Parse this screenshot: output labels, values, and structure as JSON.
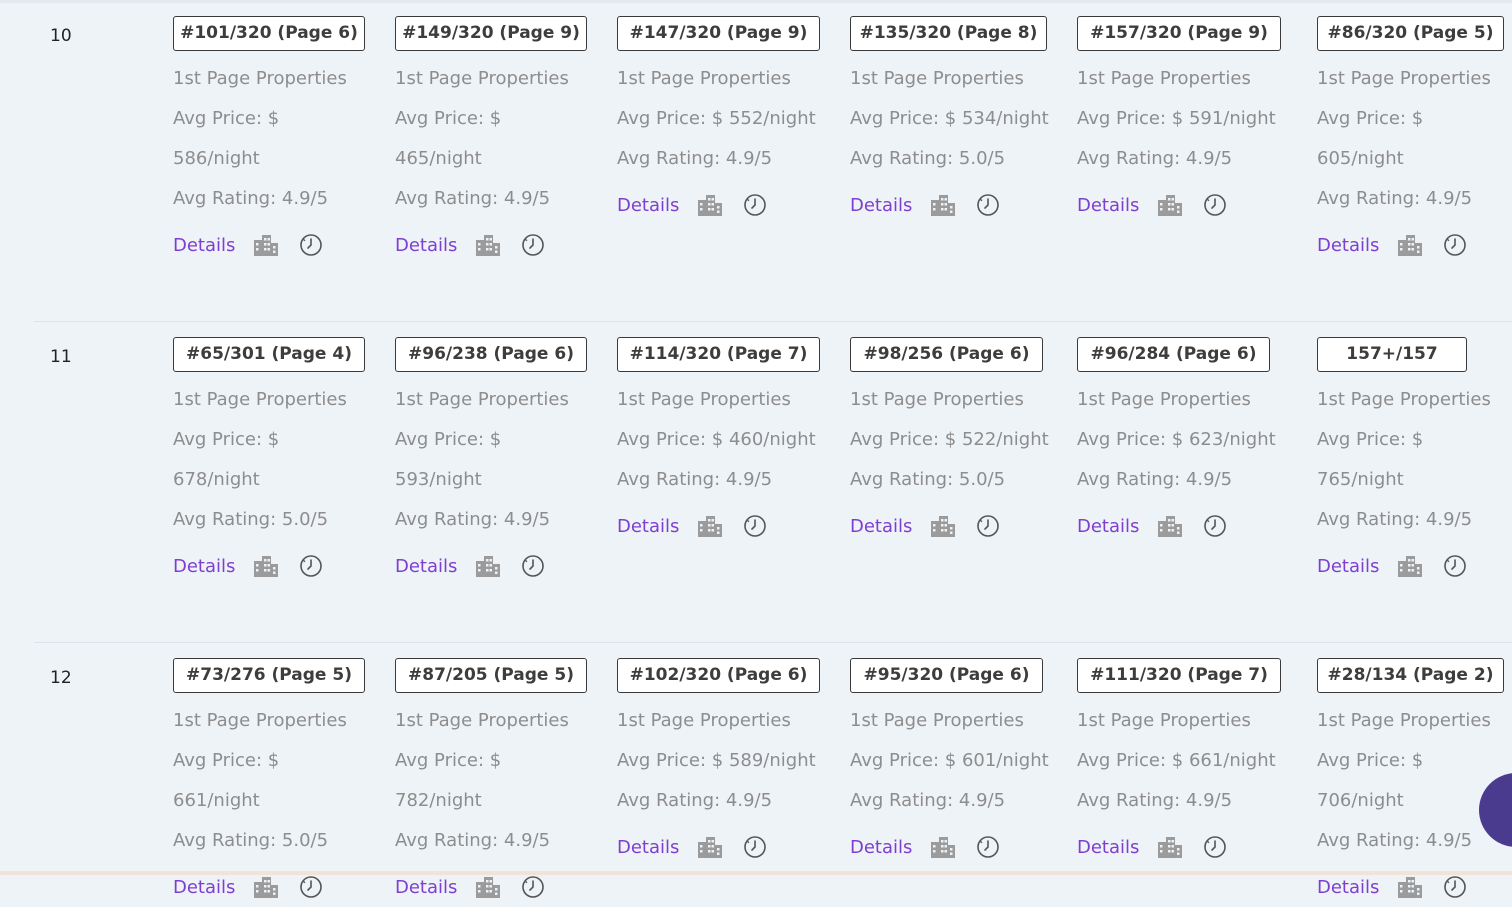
{
  "labels": {
    "first_page": "1st Page Properties",
    "avg_price_prefix": "Avg Price: $",
    "avg_rating_prefix": "Avg Rating: ",
    "details": "Details",
    "help": "?"
  },
  "rows": [
    {
      "number": "10",
      "cells": [
        {
          "rank": "#101/320 (Page 6)",
          "price": "586/night",
          "rating": "4.9/5"
        },
        {
          "rank": "#149/320 (Page 9)",
          "price": "465/night",
          "rating": "4.9/5"
        },
        {
          "rank": "#147/320 (Page 9)",
          "price": "552/night",
          "rating": "4.9/5"
        },
        {
          "rank": "#135/320 (Page 8)",
          "price": "534/night",
          "rating": "5.0/5"
        },
        {
          "rank": "#157/320 (Page 9)",
          "price": "591/night",
          "rating": "4.9/5"
        },
        {
          "rank": "#86/320 (Page 5)",
          "price": "605/night",
          "rating": "4.9/5"
        }
      ]
    },
    {
      "number": "11",
      "cells": [
        {
          "rank": "#65/301 (Page 4)",
          "price": "678/night",
          "rating": "5.0/5"
        },
        {
          "rank": "#96/238 (Page 6)",
          "price": "593/night",
          "rating": "4.9/5"
        },
        {
          "rank": "#114/320 (Page 7)",
          "price": "460/night",
          "rating": "4.9/5"
        },
        {
          "rank": "#98/256 (Page 6)",
          "price": "522/night",
          "rating": "5.0/5"
        },
        {
          "rank": "#96/284 (Page 6)",
          "price": "623/night",
          "rating": "4.9/5"
        },
        {
          "rank": "157+/157",
          "price": "765/night",
          "rating": "4.9/5"
        }
      ]
    },
    {
      "number": "12",
      "cells": [
        {
          "rank": "#73/276 (Page 5)",
          "price": "661/night",
          "rating": "5.0/5"
        },
        {
          "rank": "#87/205 (Page 5)",
          "price": "782/night",
          "rating": "4.9/5"
        },
        {
          "rank": "#102/320 (Page 6)",
          "price": "589/night",
          "rating": "4.9/5"
        },
        {
          "rank": "#95/320 (Page 6)",
          "price": "601/night",
          "rating": "4.9/5"
        },
        {
          "rank": "#111/320 (Page 7)",
          "price": "661/night",
          "rating": "4.9/5"
        },
        {
          "rank": "#28/134 (Page 2)",
          "price": "706/night",
          "rating": "4.9/5"
        }
      ]
    }
  ],
  "colors": {
    "background": "#eef3f8",
    "link": "#7e3fd1",
    "muted_text": "#8d8d8d",
    "fab": "#4a3b8f"
  },
  "icons": [
    "building-icon",
    "clock-icon"
  ]
}
